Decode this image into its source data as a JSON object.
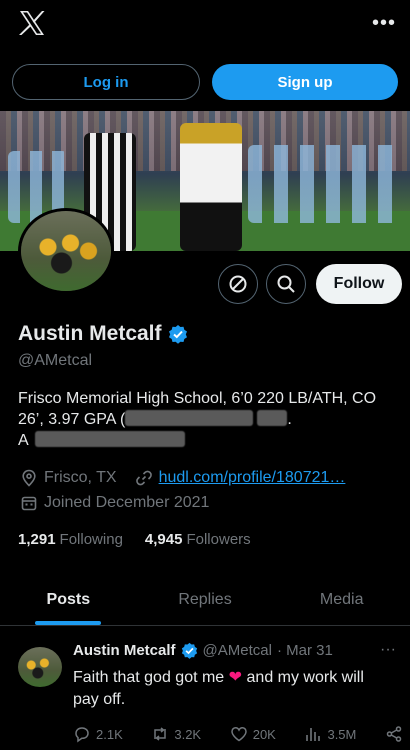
{
  "topbar": {
    "logo_icon": "x-logo-icon",
    "more_icon": "more-horizontal-icon",
    "more_glyph": "•••"
  },
  "auth": {
    "login_label": "Log in",
    "signup_label": "Sign up"
  },
  "banner": {
    "subject": "football field photo with referee and player"
  },
  "actions": {
    "block_icon": "block-icon",
    "search_icon": "search-icon",
    "follow_label": "Follow"
  },
  "profile": {
    "name": "Austin Metcalf",
    "verified_icon": "verified-badge-icon",
    "handle": "@AMetcal",
    "bio_line1": "Frisco Memorial High School, 6’0 220 LB/ATH, CO",
    "bio_line2_start": "26’, 3.97 GPA (",
    "bio_line2_end": ".",
    "bio_line3_start": "A",
    "location": "Frisco, TX",
    "link": "hudl.com/profile/180721…",
    "joined": "Joined December 2021",
    "following_count": "1,291",
    "following_label": "Following",
    "followers_count": "4,945",
    "followers_label": "Followers"
  },
  "tabs": [
    {
      "label": "Posts",
      "active": true
    },
    {
      "label": "Replies",
      "active": false
    },
    {
      "label": "Media",
      "active": false
    }
  ],
  "tweet": {
    "author": "Austin Metcalf",
    "handle": "@AMetcal",
    "date": "· Mar 31",
    "more_glyph": "···",
    "text_before": "Faith that god got me",
    "emoji": "❤",
    "text_after": "and my work will pay off.",
    "replies": "2.1K",
    "reposts": "3.2K",
    "likes": "20K",
    "views": "3.5M"
  },
  "colors": {
    "accent": "#1d9bf0",
    "background": "#000000",
    "muted": "#71767b",
    "heart": "#f91880"
  }
}
